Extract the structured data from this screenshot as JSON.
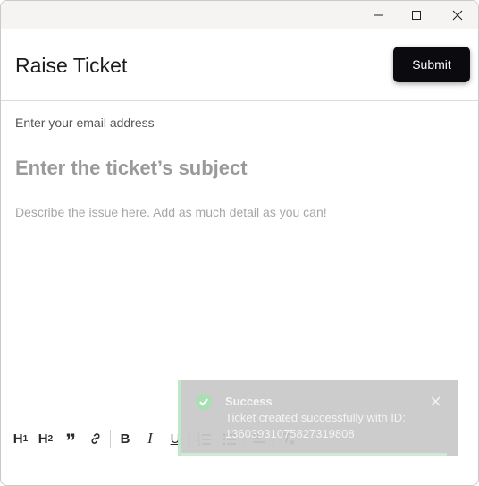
{
  "window": {
    "controls": [
      "minimize-icon",
      "maximize-icon",
      "close-icon"
    ]
  },
  "header": {
    "title": "Raise Ticket",
    "submit_label": "Submit"
  },
  "form": {
    "email_placeholder": "Enter your email address",
    "subject_placeholder": "Enter the ticket’s subject",
    "description_placeholder": "Describe the issue here. Add as much detail as you can!"
  },
  "toolbar": {
    "h1": "H",
    "h1_sub": "1",
    "h2": "H",
    "h2_sub": "2",
    "quote": "”",
    "bold": "B",
    "italic": "I",
    "underline": "U",
    "icons": [
      "link-icon",
      "ordered-list-icon",
      "bullet-list-icon",
      "align-icon",
      "clear-format-icon"
    ]
  },
  "toast": {
    "title": "Success",
    "message": "Ticket created successfully with ID: 1360393107582731980 8",
    "message_text": "Ticket created successfully with ID: 13603931075827319808",
    "accent_color": "#bfe8c8",
    "progress": 0.96
  }
}
